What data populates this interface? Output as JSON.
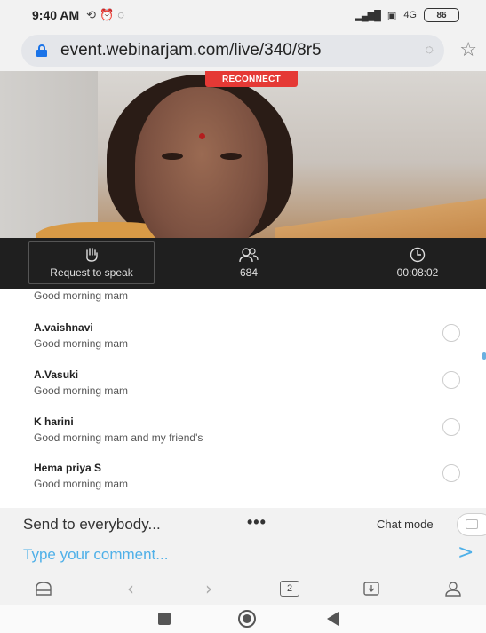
{
  "status_bar": {
    "time": "9:40 AM",
    "left_icons": [
      "sync-icon",
      "alarm-icon",
      "whatsapp-icon"
    ],
    "signal_text": "4G",
    "battery": "86"
  },
  "browser": {
    "url": "event.webinarjam.com/live/340/8r5",
    "tab_count": "2"
  },
  "video": {
    "reconnect_label": "RECONNECT"
  },
  "controls": {
    "request_to_speak": "Request to speak",
    "attendee_count": "684",
    "elapsed_time": "00:08:02"
  },
  "chat": {
    "partial_message": "Good morning mam",
    "messages": [
      {
        "name": "A.vaishnavi",
        "text": "Good morning mam"
      },
      {
        "name": "A.Vasuki",
        "text": "Good morning mam"
      },
      {
        "name": "K harini",
        "text": "Good morning mam and my friend's"
      },
      {
        "name": "Hema priya S",
        "text": "Good morning mam"
      }
    ]
  },
  "compose": {
    "send_to": "Send to everybody...",
    "more": "•••",
    "chat_mode": "Chat mode",
    "comment_placeholder": "Type your comment...",
    "send_glyph": ">"
  },
  "colors": {
    "reconnect_bg": "#e53935",
    "control_bar_bg": "#1f1f1f",
    "accent_blue": "#4fb0e8",
    "lock_blue": "#1a73e8"
  }
}
